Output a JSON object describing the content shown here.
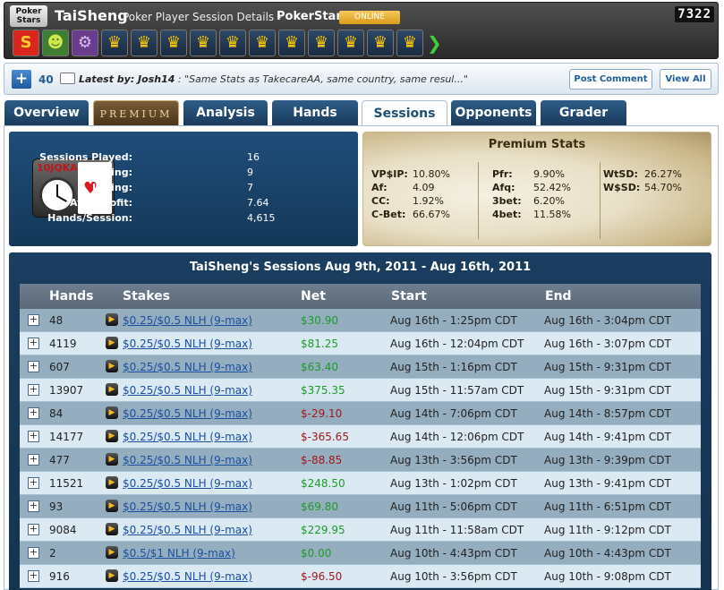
{
  "header": {
    "logo_text": "Poker Stars",
    "player_name": "TaiSheng",
    "page_subtitle": "Poker Player Session Details -",
    "site_name": "PokerStars",
    "status_badge": "ONLINE",
    "score": "7322",
    "achievement_icons": [
      "s-badge-icon",
      "monster-icon",
      "robot-icon",
      "crown-icon",
      "crown-icon",
      "crown-icon",
      "crown-icon",
      "crown-icon",
      "crown-icon",
      "crown-icon",
      "crown-icon",
      "crown-icon",
      "crown-icon",
      "crown-icon"
    ]
  },
  "comments": {
    "count": "40",
    "latest_prefix": "Latest by: Josh14",
    "latest_text": ": \"Same Stats as TakecareAA, same country, same resul...\"",
    "post_label": "Post Comment",
    "view_label": "View All"
  },
  "tabs": [
    {
      "label": "Overview",
      "active": false
    },
    {
      "label": "PREMIUM",
      "active": false
    },
    {
      "label": "Analysis",
      "active": false
    },
    {
      "label": "Hands",
      "active": false
    },
    {
      "label": "Sessions",
      "active": true
    },
    {
      "label": "Opponents",
      "active": false
    },
    {
      "label": "Grader",
      "active": false
    }
  ],
  "summary": {
    "icon_cards": "10JQKA",
    "stats": [
      {
        "label": "Sessions Played:",
        "value": "16"
      },
      {
        "label": "Winning:",
        "value": "9"
      },
      {
        "label": "Losing:",
        "value": "7"
      },
      {
        "label": "Avg. Profit:",
        "value": "7.64"
      },
      {
        "label": "Hands/Session:",
        "value": "4,615"
      }
    ]
  },
  "premium": {
    "title": "Premium Stats",
    "col1": [
      {
        "label": "VP$IP:",
        "value": "10.80%"
      },
      {
        "label": "Af:",
        "value": "4.09"
      },
      {
        "label": "CC:",
        "value": "1.92%"
      },
      {
        "label": "C-Bet:",
        "value": "66.67%"
      }
    ],
    "col2": [
      {
        "label": "Pfr:",
        "value": "9.90%"
      },
      {
        "label": "Afq:",
        "value": "52.42%"
      },
      {
        "label": "3bet:",
        "value": "6.20%"
      },
      {
        "label": "4bet:",
        "value": "11.58%"
      }
    ],
    "col3": [
      {
        "label": "WtSD:",
        "value": "26.27%"
      },
      {
        "label": "W$SD:",
        "value": "54.70%"
      }
    ]
  },
  "sessions": {
    "title": "TaiSheng's Sessions Aug 9th, 2011 - Aug 16th, 2011",
    "headers": [
      "Hands",
      "Stakes",
      "Net",
      "Start",
      "End"
    ],
    "rows": [
      {
        "hands": "48",
        "stakes": "$0.25/$0.5 NLH (9-max)",
        "net": "$30.90",
        "sign": "pos",
        "start": "Aug 16th - 1:25pm CDT",
        "end": "Aug 16th - 3:04pm CDT"
      },
      {
        "hands": "4119",
        "stakes": "$0.25/$0.5 NLH (9-max)",
        "net": "$81.25",
        "sign": "pos",
        "start": "Aug 16th - 12:04pm CDT",
        "end": "Aug 16th - 3:07pm CDT"
      },
      {
        "hands": "607",
        "stakes": "$0.25/$0.5 NLH (9-max)",
        "net": "$63.40",
        "sign": "pos",
        "start": "Aug 15th - 1:16pm CDT",
        "end": "Aug 15th - 9:31pm CDT"
      },
      {
        "hands": "13907",
        "stakes": "$0.25/$0.5 NLH (9-max)",
        "net": "$375.35",
        "sign": "pos",
        "start": "Aug 15th - 11:57am CDT",
        "end": "Aug 15th - 9:31pm CDT"
      },
      {
        "hands": "84",
        "stakes": "$0.25/$0.5 NLH (9-max)",
        "net": "$-29.10",
        "sign": "neg",
        "start": "Aug 14th - 7:06pm CDT",
        "end": "Aug 14th - 8:57pm CDT"
      },
      {
        "hands": "14177",
        "stakes": "$0.25/$0.5 NLH (9-max)",
        "net": "$-365.65",
        "sign": "neg",
        "start": "Aug 14th - 12:06pm CDT",
        "end": "Aug 14th - 9:41pm CDT"
      },
      {
        "hands": "477",
        "stakes": "$0.25/$0.5 NLH (9-max)",
        "net": "$-88.85",
        "sign": "neg",
        "start": "Aug 13th - 3:56pm CDT",
        "end": "Aug 13th - 9:39pm CDT"
      },
      {
        "hands": "11521",
        "stakes": "$0.25/$0.5 NLH (9-max)",
        "net": "$248.50",
        "sign": "pos",
        "start": "Aug 13th - 1:02pm CDT",
        "end": "Aug 13th - 9:41pm CDT"
      },
      {
        "hands": "93",
        "stakes": "$0.25/$0.5 NLH (9-max)",
        "net": "$69.80",
        "sign": "pos",
        "start": "Aug 11th - 5:06pm CDT",
        "end": "Aug 11th - 6:51pm CDT"
      },
      {
        "hands": "9084",
        "stakes": "$0.25/$0.5 NLH (9-max)",
        "net": "$229.95",
        "sign": "pos",
        "start": "Aug 11th - 11:58am CDT",
        "end": "Aug 11th - 9:12pm CDT"
      },
      {
        "hands": "2",
        "stakes": "$0.5/$1 NLH (9-max)",
        "net": "$0.00",
        "sign": "pos",
        "start": "Aug 10th - 4:43pm CDT",
        "end": "Aug 10th - 4:43pm CDT"
      },
      {
        "hands": "916",
        "stakes": "$0.25/$0.5 NLH (9-max)",
        "net": "$-96.50",
        "sign": "neg",
        "start": "Aug 10th - 3:56pm CDT",
        "end": "Aug 10th - 9:08pm CDT"
      }
    ]
  }
}
